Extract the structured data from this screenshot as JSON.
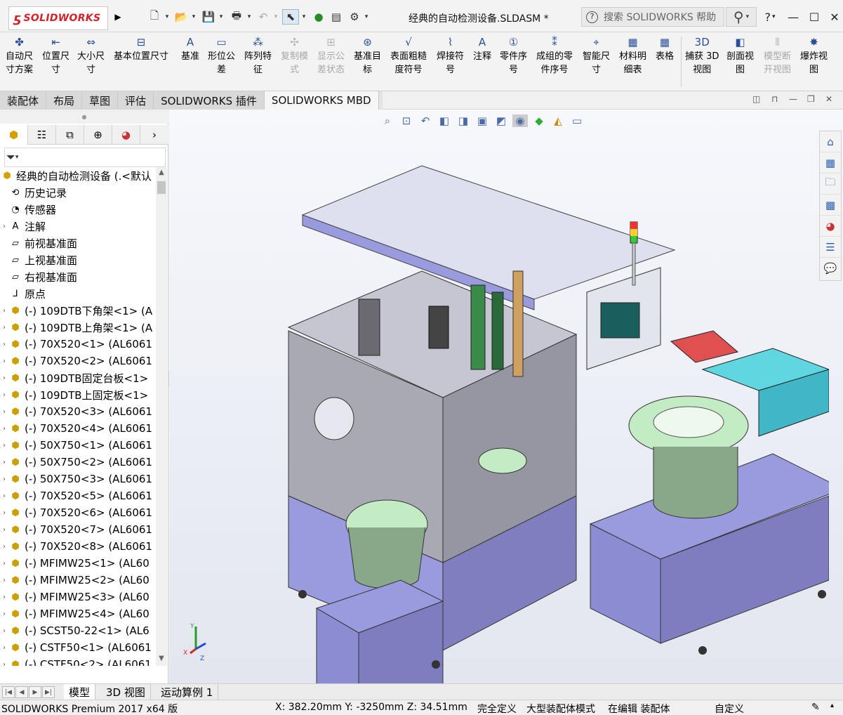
{
  "app": {
    "logo_text": "SOLIDWORKS",
    "document_title": "经典的自动检测设备.SLDASM *",
    "search_placeholder": "搜索 SOLIDWORKS 帮助",
    "help_label": "?"
  },
  "toolbar": {
    "items": [
      {
        "label": "自动尺\n寸方案",
        "icon": "auto-dimension-icon",
        "disabled": false
      },
      {
        "label": "位置尺\n寸",
        "icon": "location-dimension-icon",
        "disabled": false
      },
      {
        "label": "大小尺\n寸",
        "icon": "size-dimension-icon",
        "disabled": false
      },
      {
        "label": "基本位置尺寸",
        "icon": "basic-location-dimension-icon",
        "disabled": false
      },
      {
        "label": "基准",
        "icon": "datum-icon",
        "disabled": false
      },
      {
        "label": "形位公\n差",
        "icon": "geometric-tolerance-icon",
        "disabled": false
      },
      {
        "label": "阵列特\n征",
        "icon": "pattern-feature-icon",
        "disabled": false
      },
      {
        "label": "复制模\n式",
        "icon": "copy-scheme-icon",
        "disabled": true
      },
      {
        "label": "显示公\n差状态",
        "icon": "tolerance-status-icon",
        "disabled": true
      },
      {
        "label": "基准目\n标",
        "icon": "datum-target-icon",
        "disabled": false
      },
      {
        "label": "表面粗糙\n度符号",
        "icon": "surface-finish-icon",
        "disabled": false
      },
      {
        "label": "焊接符\n号",
        "icon": "weld-symbol-icon",
        "disabled": false
      },
      {
        "label": "注释",
        "icon": "note-icon",
        "disabled": false
      },
      {
        "label": "零件序\n号",
        "icon": "balloon-icon",
        "disabled": false
      },
      {
        "label": "成组的零\n件序号",
        "icon": "stacked-balloon-icon",
        "disabled": false
      },
      {
        "label": "智能尺\n寸",
        "icon": "smart-dimension-icon",
        "disabled": false
      },
      {
        "label": "材料明\n细表",
        "icon": "bom-icon",
        "disabled": false
      },
      {
        "label": "表格",
        "icon": "table-icon",
        "disabled": false
      },
      {
        "label": "捕获 3D\n视图",
        "icon": "capture-3d-view-icon",
        "disabled": false
      },
      {
        "label": "剖面视\n图",
        "icon": "section-view-icon",
        "disabled": false
      },
      {
        "label": "模型断\n开视图",
        "icon": "model-break-view-icon",
        "disabled": true
      },
      {
        "label": "爆炸视\n图",
        "icon": "exploded-view-icon",
        "disabled": false
      }
    ]
  },
  "tabs": [
    "装配体",
    "布局",
    "草图",
    "评估",
    "SOLIDWORKS 插件",
    "SOLIDWORKS MBD"
  ],
  "active_tab": "SOLIDWORKS MBD",
  "tree": {
    "root": "经典的自动检测设备 (.<默认",
    "items": [
      {
        "label": "历史记录",
        "icon": "history-icon",
        "expandable": false
      },
      {
        "label": "传感器",
        "icon": "sensor-icon",
        "expandable": false
      },
      {
        "label": "注解",
        "icon": "annotation-icon",
        "expandable": true
      },
      {
        "label": "前视基准面",
        "icon": "plane-icon",
        "expandable": false
      },
      {
        "label": "上视基准面",
        "icon": "plane-icon",
        "expandable": false
      },
      {
        "label": "右视基准面",
        "icon": "plane-icon",
        "expandable": false
      },
      {
        "label": "原点",
        "icon": "origin-icon",
        "expandable": false
      },
      {
        "label": "(-) 109DTB下角架<1> (A",
        "icon": "part-icon",
        "expandable": true
      },
      {
        "label": "(-) 109DTB上角架<1> (A",
        "icon": "part-icon",
        "expandable": true
      },
      {
        "label": "(-) 70X520<1> (AL6061",
        "icon": "part-icon",
        "expandable": true
      },
      {
        "label": "(-) 70X520<2> (AL6061",
        "icon": "part-icon",
        "expandable": true
      },
      {
        "label": "(-) 109DTB固定台板<1>",
        "icon": "part-icon",
        "expandable": true
      },
      {
        "label": "(-) 109DTB上固定板<1>",
        "icon": "part-icon",
        "expandable": true
      },
      {
        "label": "(-) 70X520<3> (AL6061",
        "icon": "part-icon",
        "expandable": true
      },
      {
        "label": "(-) 70X520<4> (AL6061",
        "icon": "part-icon",
        "expandable": true
      },
      {
        "label": "(-) 50X750<1> (AL6061",
        "icon": "part-icon",
        "expandable": true
      },
      {
        "label": "(-) 50X750<2> (AL6061",
        "icon": "part-icon",
        "expandable": true
      },
      {
        "label": "(-) 50X750<3> (AL6061",
        "icon": "part-icon",
        "expandable": true
      },
      {
        "label": "(-) 70X520<5> (AL6061",
        "icon": "part-icon",
        "expandable": true
      },
      {
        "label": "(-) 70X520<6> (AL6061",
        "icon": "part-icon",
        "expandable": true
      },
      {
        "label": "(-) 70X520<7> (AL6061",
        "icon": "part-icon",
        "expandable": true
      },
      {
        "label": "(-) 70X520<8> (AL6061",
        "icon": "part-icon",
        "expandable": true
      },
      {
        "label": "(-) MFIMW25<1> (AL60",
        "icon": "part-icon",
        "expandable": true
      },
      {
        "label": "(-) MFIMW25<2> (AL60",
        "icon": "part-icon",
        "expandable": true
      },
      {
        "label": "(-) MFIMW25<3> (AL60",
        "icon": "part-icon",
        "expandable": true
      },
      {
        "label": "(-) MFIMW25<4> (AL60",
        "icon": "part-icon",
        "expandable": true
      },
      {
        "label": "(-) SCST50-22<1> (AL6",
        "icon": "part-icon",
        "expandable": true
      },
      {
        "label": "(-) CSTF50<1> (AL6061",
        "icon": "part-icon",
        "expandable": true
      },
      {
        "label": "(-) CSTF50<2> (AL6061",
        "icon": "part-icon",
        "expandable": true
      }
    ]
  },
  "bottom_tabs": [
    "模型",
    "3D 视图",
    "运动算例 1"
  ],
  "active_bottom_tab": "模型",
  "status": {
    "product": "SOLIDWORKS Premium 2017 x64 版",
    "coords": "X: 382.20mm Y: -3250mm Z: 34.51mm",
    "defined": "完全定义",
    "mode": "大型装配体模式",
    "editing": "在编辑 装配体",
    "units": "自定义"
  },
  "triad": {
    "x": "X",
    "y": "Y",
    "z": "Z"
  },
  "colors": {
    "brand": "#d2232a",
    "frame": "#9a9ade",
    "bowl": "#c4ecc4",
    "bin_cyan": "#5fd6e0",
    "bin_red": "#e05050"
  }
}
